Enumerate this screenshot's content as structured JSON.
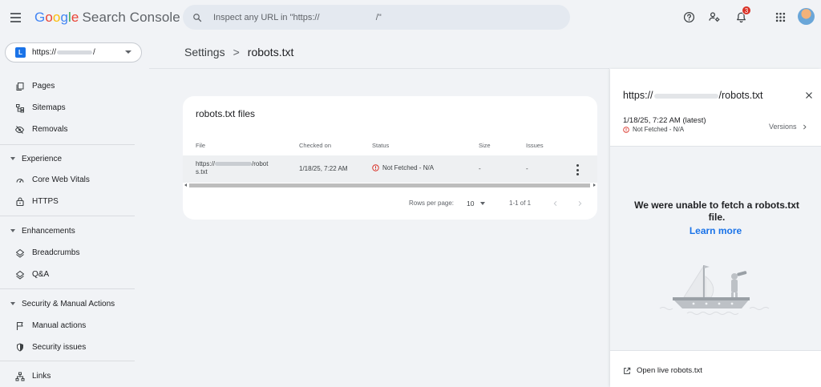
{
  "app": {
    "logo_letters": [
      "G",
      "o",
      "o",
      "g",
      "l",
      "e"
    ],
    "product_name": "Search Console"
  },
  "search": {
    "placeholder": "Inspect any URL in \"https://                       /\""
  },
  "notifications": {
    "count": "3"
  },
  "property": {
    "badge": "L",
    "url_prefix": "https://",
    "url_suffix": "/"
  },
  "sidebar": {
    "items": [
      {
        "label": "Pages",
        "icon": "pages-icon"
      },
      {
        "label": "Sitemaps",
        "icon": "sitemaps-icon"
      },
      {
        "label": "Removals",
        "icon": "removals-icon"
      }
    ],
    "sections": [
      {
        "label": "Experience",
        "items": [
          {
            "label": "Core Web Vitals",
            "icon": "gauge-icon"
          },
          {
            "label": "HTTPS",
            "icon": "lock-icon"
          }
        ]
      },
      {
        "label": "Enhancements",
        "items": [
          {
            "label": "Breadcrumbs",
            "icon": "layers-icon"
          },
          {
            "label": "Q&A",
            "icon": "layers-icon"
          }
        ]
      },
      {
        "label": "Security & Manual Actions",
        "items": [
          {
            "label": "Manual actions",
            "icon": "flag-icon"
          },
          {
            "label": "Security issues",
            "icon": "shield-icon"
          }
        ]
      }
    ],
    "links": {
      "label": "Links",
      "icon": "links-icon"
    }
  },
  "breadcrumb": {
    "parent": "Settings",
    "separator": ">",
    "current": "robots.txt"
  },
  "card": {
    "title": "robots.txt files",
    "columns": [
      "File",
      "Checked on",
      "Status",
      "Size",
      "Issues"
    ],
    "rows": [
      {
        "file_prefix": "https://",
        "file_suffix": "/robot",
        "file_line2": "s.txt",
        "checked_on": "1/18/25, 7:22 AM",
        "status": "Not Fetched - N/A",
        "size": "-",
        "issues": "-"
      }
    ],
    "pagination": {
      "rows_per_page_label": "Rows per page:",
      "rows_per_page_value": "10",
      "range": "1-1 of 1"
    }
  },
  "panel": {
    "title_prefix": "https://",
    "title_suffix": "/robots.txt",
    "date": "1/18/25, 7:22 AM (latest)",
    "status": "Not Fetched - N/A",
    "versions_label": "Versions",
    "message": "We were unable to fetch a robots.txt file.",
    "learn_more": "Learn more",
    "open_live": "Open live robots.txt"
  },
  "colors": {
    "accent": "#1a73e8",
    "error": "#d93025",
    "background": "#f1f3f6"
  }
}
